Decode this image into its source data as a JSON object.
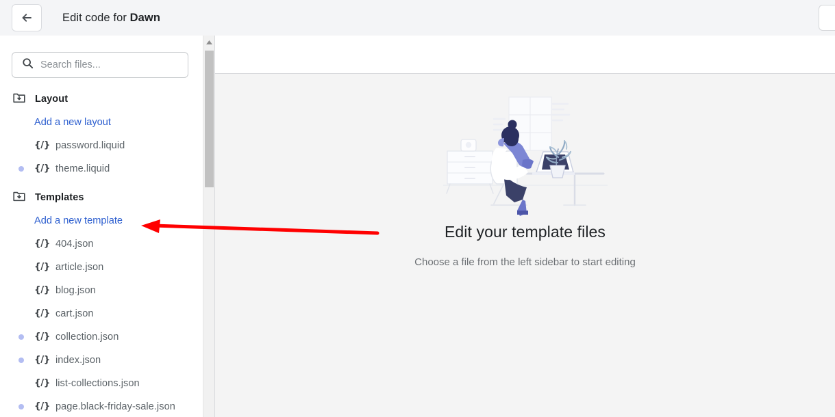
{
  "header": {
    "back_icon": "arrow-left-icon",
    "title_prefix": "Edit code for ",
    "title_theme": "Dawn"
  },
  "search": {
    "icon": "search-icon",
    "placeholder": "Search files...",
    "value": ""
  },
  "sidebar": {
    "groups": [
      {
        "icon": "folder-down-icon",
        "label": "Layout",
        "add_link": "Add a new layout",
        "files": [
          {
            "glyph": "{/}",
            "name": "password.liquid",
            "modified": false
          },
          {
            "glyph": "{/}",
            "name": "theme.liquid",
            "modified": true
          }
        ]
      },
      {
        "icon": "folder-down-icon",
        "label": "Templates",
        "add_link": "Add a new template",
        "files": [
          {
            "glyph": "{/}",
            "name": "404.json",
            "modified": false
          },
          {
            "glyph": "{/}",
            "name": "article.json",
            "modified": false
          },
          {
            "glyph": "{/}",
            "name": "blog.json",
            "modified": false
          },
          {
            "glyph": "{/}",
            "name": "cart.json",
            "modified": false
          },
          {
            "glyph": "{/}",
            "name": "collection.json",
            "modified": true
          },
          {
            "glyph": "{/}",
            "name": "index.json",
            "modified": true
          },
          {
            "glyph": "{/}",
            "name": "list-collections.json",
            "modified": false
          },
          {
            "glyph": "{/}",
            "name": "page.black-friday-sale.json",
            "modified": true
          }
        ]
      }
    ]
  },
  "scrollbar": {
    "up_arrow_icon": "triangle-up-icon"
  },
  "main": {
    "empty_state": {
      "illustration": "person-at-desk-illustration",
      "title": "Edit your template files",
      "subtitle": "Choose a file from the left sidebar to start editing"
    }
  },
  "annotation": {
    "type": "arrow",
    "color": "#ff0000",
    "points_to": "Add a new template"
  },
  "colors": {
    "header_bg": "#f4f5f7",
    "link_blue": "#2c5ecf",
    "modified_dot": "#b3bdf2",
    "canvas_bg": "#f4f4f4",
    "annotation_red": "#ff0000"
  }
}
